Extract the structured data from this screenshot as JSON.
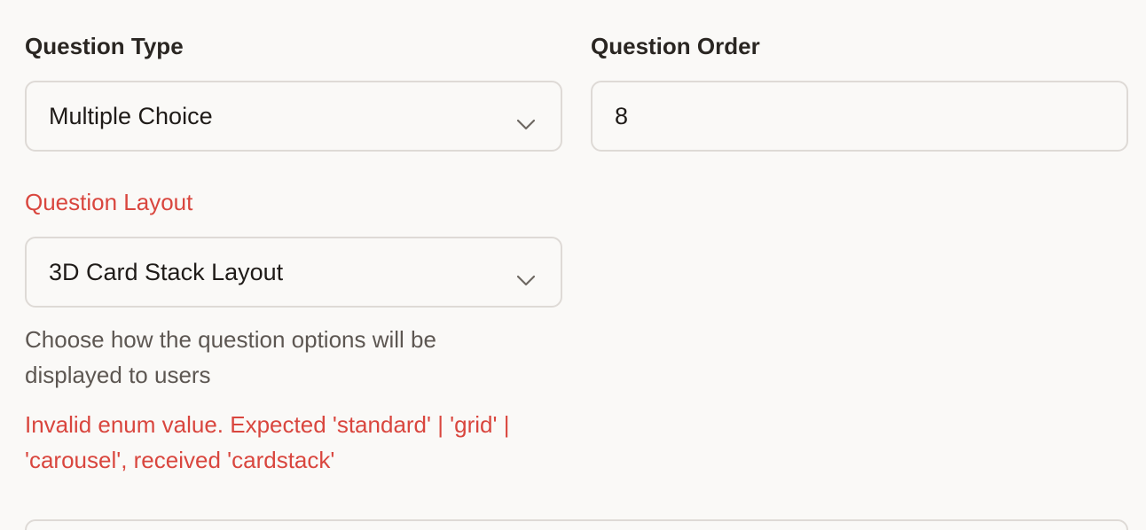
{
  "question_type": {
    "label": "Question Type",
    "selected": "Multiple Choice"
  },
  "question_order": {
    "label": "Question Order",
    "value": "8"
  },
  "question_layout": {
    "label": "Question Layout",
    "selected": "3D Card Stack Layout",
    "help_text": "Choose how the question options will be displayed to users",
    "error_text": "Invalid enum value. Expected 'standard' | 'grid' | 'carousel', received 'cardstack'"
  },
  "colors": {
    "error": "#d9463e",
    "border": "#dedad6",
    "background": "#faf9f7"
  },
  "icons": {
    "dropdown": "chevron-down-icon"
  }
}
